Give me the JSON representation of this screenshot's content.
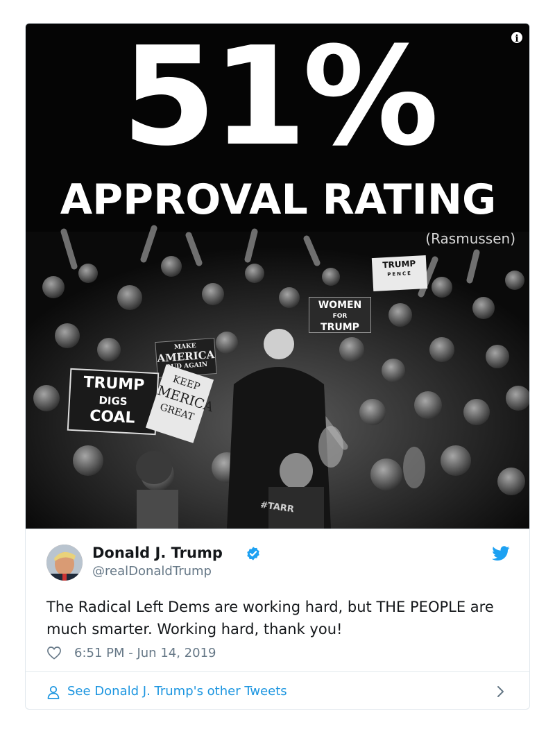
{
  "media": {
    "headline_number": "51%",
    "headline_text": "APPROVAL RATING",
    "source": "(Rasmussen)",
    "signs": {
      "coal_line1": "TRUMP",
      "coal_line2": "DIGS",
      "coal_line3": "COAL",
      "keep_line1": "KEEP",
      "keep_line2": "MERICA",
      "keep_line3": "GREAT",
      "make_line1": "MAKE",
      "make_line2": "AMERICA",
      "make_line3": "OUD AGAIN",
      "women_line1": "WOMEN",
      "women_line2": "FOR",
      "women_line3": "TRUMP",
      "pence_line1": "TRUMP",
      "pence_line2": "PENCE",
      "tarr": "#TARR"
    }
  },
  "tweet": {
    "author_name": "Donald J. Trump",
    "handle": "@realDonaldTrump",
    "text": "The Radical Left Dems are working hard, but THE PEOPLE are much smarter. Working hard, thank you!",
    "timestamp": "6:51 PM - Jun 14, 2019"
  },
  "footer": {
    "link_text": "See Donald J. Trump's other Tweets"
  },
  "colors": {
    "link": "#1b95e0",
    "verified": "#1da1f2",
    "secondary_text": "#657786"
  },
  "icons": [
    "info-icon",
    "verified-badge-icon",
    "twitter-bird-icon",
    "heart-icon",
    "user-icon",
    "chevron-right-icon"
  ]
}
